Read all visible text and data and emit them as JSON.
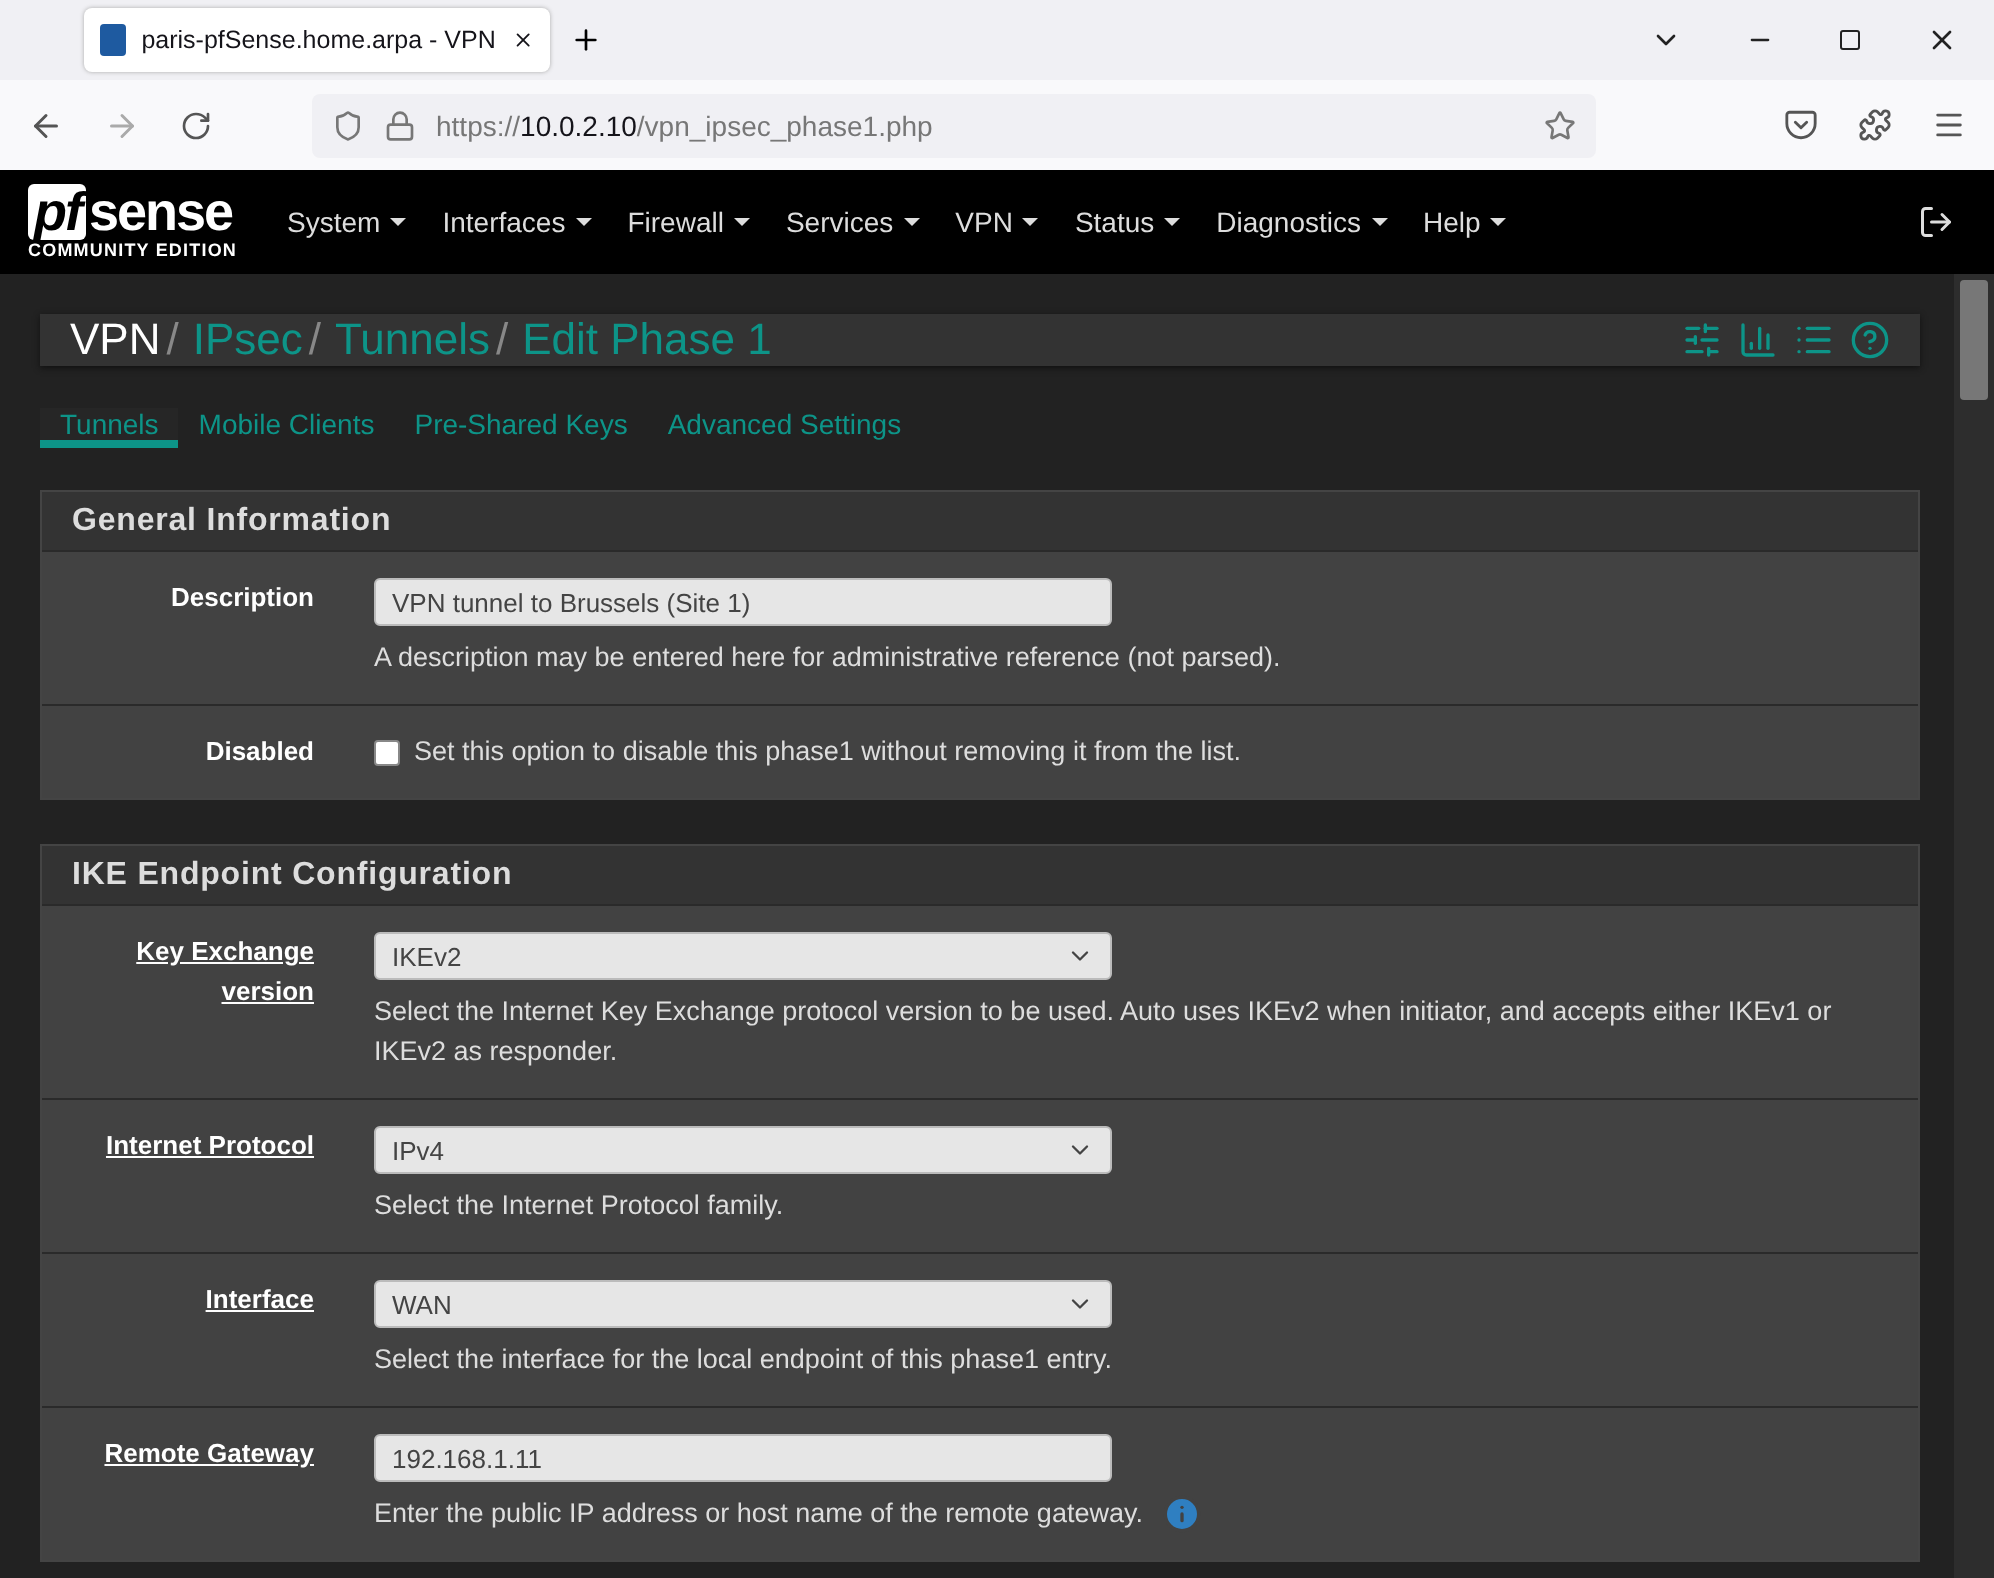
{
  "browser": {
    "tab_title": "paris-pfSense.home.arpa - VPN",
    "url_scheme": "https://",
    "url_host": "10.0.2.10",
    "url_path": "/vpn_ipsec_phase1.php"
  },
  "navbar": {
    "logo_pf": "pf",
    "logo_sense": "sense",
    "logo_sub": "COMMUNITY EDITION",
    "menus": [
      "System",
      "Interfaces",
      "Firewall",
      "Services",
      "VPN",
      "Status",
      "Diagnostics",
      "Help"
    ]
  },
  "breadcrumb_separator": "/",
  "breadcrumb": [
    {
      "label": "VPN",
      "link": false
    },
    {
      "label": "IPsec",
      "link": true
    },
    {
      "label": "Tunnels",
      "link": true
    },
    {
      "label": "Edit Phase 1",
      "link": true
    }
  ],
  "tabs": [
    {
      "label": "Tunnels",
      "selected": true
    },
    {
      "label": "Mobile Clients",
      "selected": false
    },
    {
      "label": "Pre-Shared Keys",
      "selected": false
    },
    {
      "label": "Advanced Settings",
      "selected": false
    }
  ],
  "sections": [
    {
      "title": "General Information",
      "rows": [
        {
          "label": "Description",
          "help_link": false,
          "kind": "text",
          "value": "VPN tunnel to Brussels (Site 1)",
          "hint": "A description may be entered here for administrative reference (not parsed)."
        },
        {
          "label": "Disabled",
          "help_link": false,
          "kind": "checkbox",
          "checked": false,
          "hint": "Set this option to disable this phase1 without removing it from the list."
        }
      ]
    },
    {
      "title": "IKE Endpoint Configuration",
      "rows": [
        {
          "label": "Key Exchange version",
          "help_link": true,
          "kind": "select",
          "value": "IKEv2",
          "hint": "Select the Internet Key Exchange protocol version to be used. Auto uses IKEv2 when initiator, and accepts either IKEv1 or IKEv2 as responder."
        },
        {
          "label": "Internet Protocol",
          "help_link": true,
          "kind": "select",
          "value": "IPv4",
          "hint": "Select the Internet Protocol family."
        },
        {
          "label": "Interface",
          "help_link": true,
          "kind": "select",
          "value": "WAN",
          "hint": "Select the interface for the local endpoint of this phase1 entry."
        },
        {
          "label": "Remote Gateway",
          "help_link": true,
          "kind": "text",
          "value": "192.168.1.11",
          "hint": "Enter the public IP address or host name of the remote gateway.",
          "info": true
        }
      ]
    }
  ]
}
